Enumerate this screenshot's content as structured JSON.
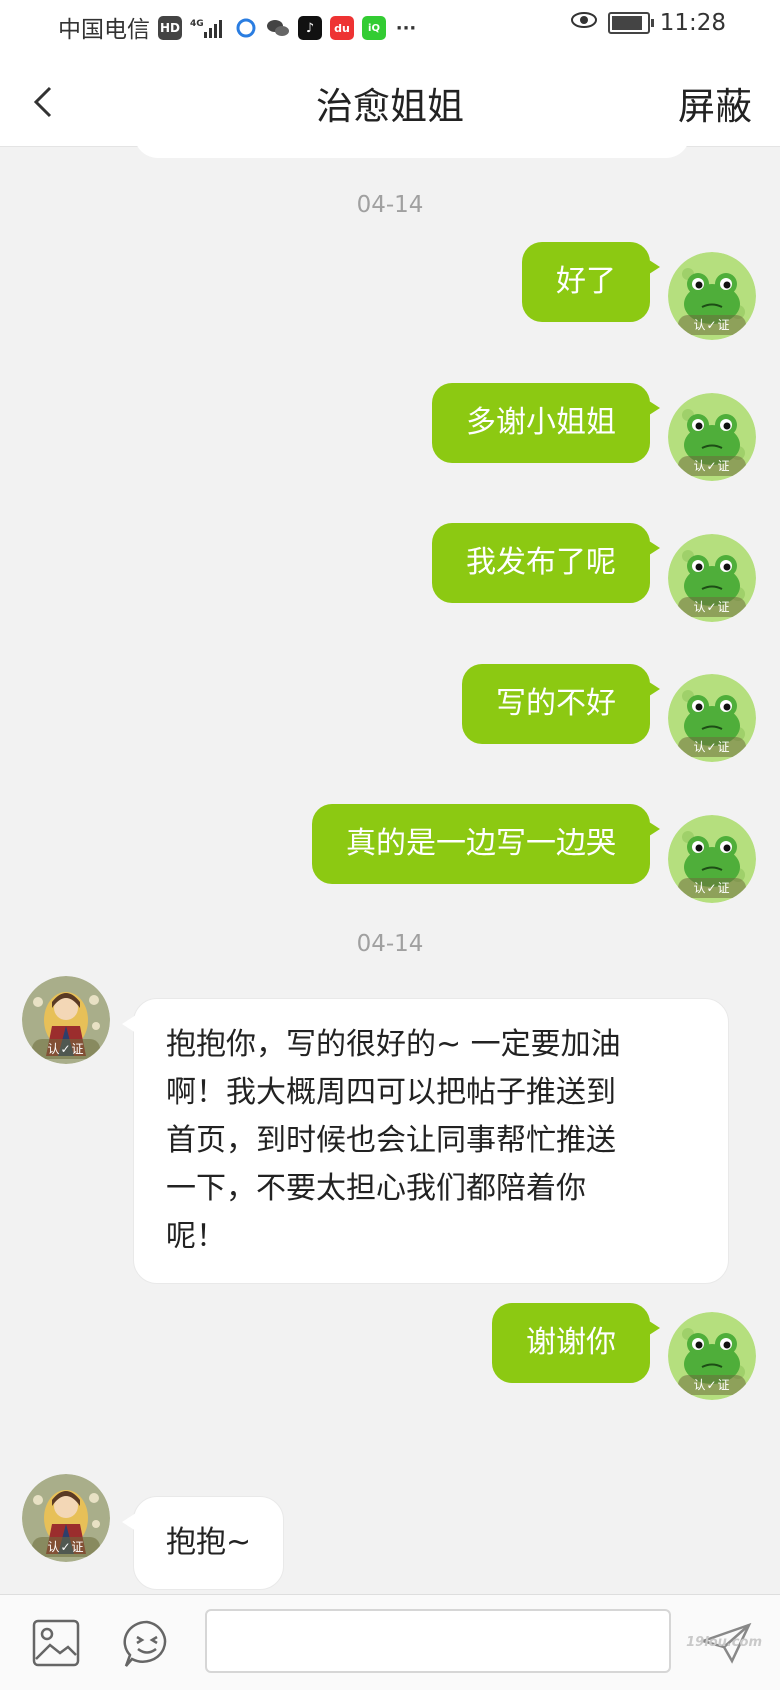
{
  "status_bar": {
    "carrier": "中国电信",
    "hd": "HD",
    "network": "4G",
    "time": "11:28",
    "icons": [
      "hd-icon",
      "signal-icon",
      "browser-icon",
      "wechat-icon",
      "tiktok-icon",
      "map-icon",
      "iqiyi-icon",
      "more-icon",
      "eye-icon",
      "battery-icon"
    ]
  },
  "header": {
    "back_icon": "chevron-left-icon",
    "title": "治愈姐姐",
    "action": "屏蔽"
  },
  "chat": {
    "timestamps": [
      "04-14",
      "04-14"
    ],
    "badge_text": "认✓证",
    "messages": [
      {
        "side": "out",
        "text": "好了"
      },
      {
        "side": "out",
        "text": "多谢小姐姐"
      },
      {
        "side": "out",
        "text": "我发布了呢"
      },
      {
        "side": "out",
        "text": "写的不好"
      },
      {
        "side": "out",
        "text": "真的是一边写一边哭"
      },
      {
        "side": "in",
        "lines": [
          "抱抱你，写的很好的~ 一定要加油",
          "啊！我大概周四可以把帖子推送到",
          "首页，到时候也会让同事帮忙推送",
          "一下，不要太担心我们都陪着你",
          "呢！"
        ]
      },
      {
        "side": "out",
        "text": "谢谢你"
      },
      {
        "side": "in",
        "text": "抱抱~"
      }
    ]
  },
  "input_bar": {
    "image_icon": "image-icon",
    "emoji_icon": "emoji-icon",
    "send_icon": "send-icon",
    "text_value": "",
    "watermark": "19lou.com"
  },
  "colors": {
    "out_bubble": "#8cc912",
    "in_bubble": "#ffffff",
    "background": "#f2f2f2"
  }
}
